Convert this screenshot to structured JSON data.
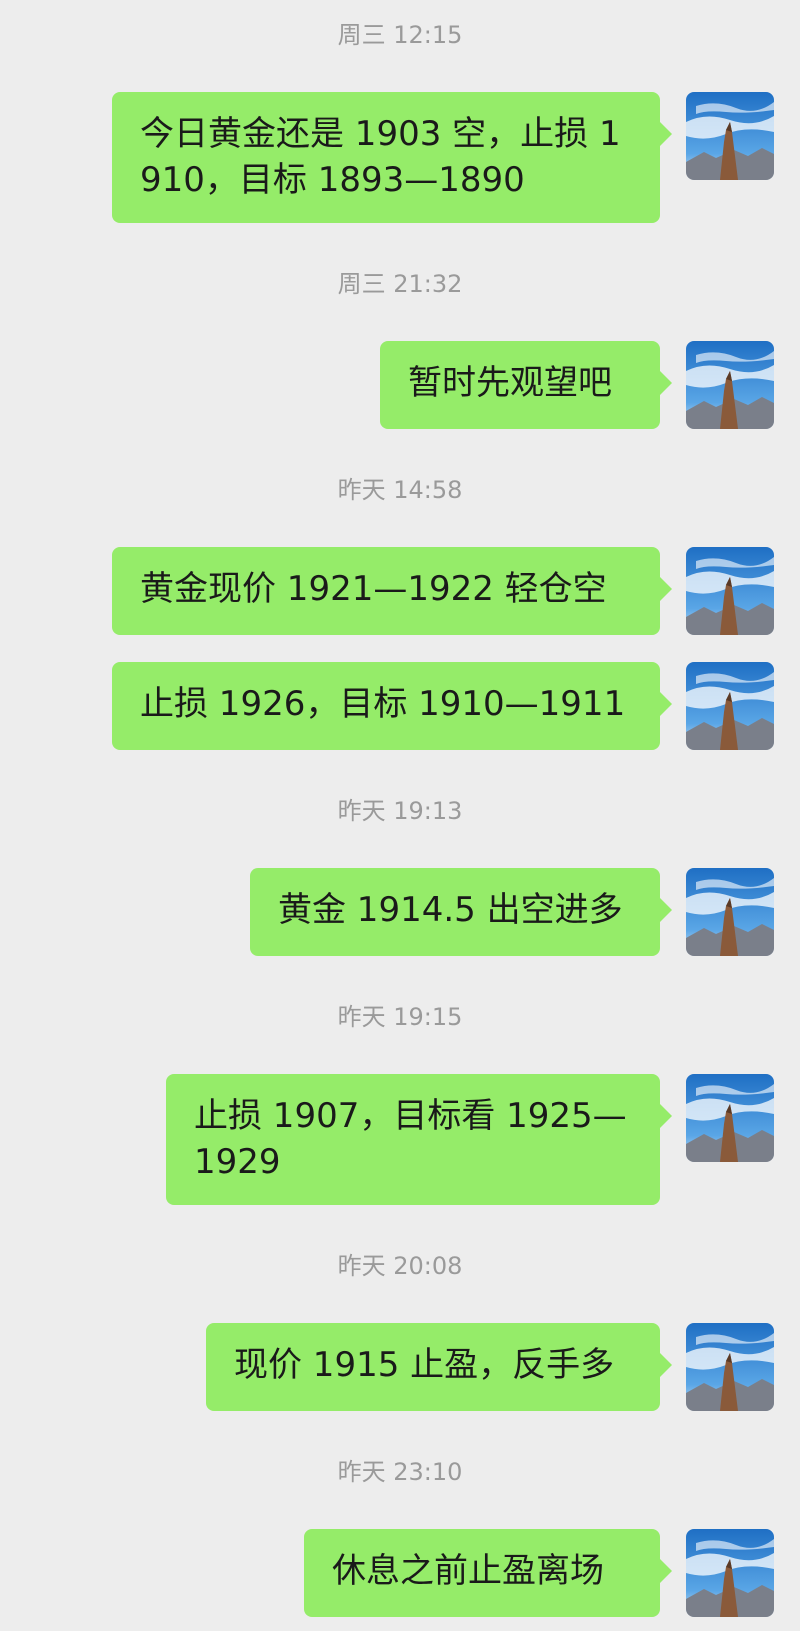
{
  "chat": {
    "messages": [
      {
        "time": "周三 12:15",
        "bubbles": [
          "今日黄金还是 1903 空，止损 1910，目标 1893—1890"
        ]
      },
      {
        "time": "周三 21:32",
        "bubbles": [
          "暂时先观望吧"
        ]
      },
      {
        "time": "昨天 14:58",
        "bubbles": [
          "黄金现价 1921—1922 轻仓空",
          "止损 1926，目标 1910—1911"
        ]
      },
      {
        "time": "昨天 19:13",
        "bubbles": [
          "黄金 1914.5 出空进多"
        ]
      },
      {
        "time": "昨天 19:15",
        "bubbles": [
          "止损 1907，目标看 1925—1929"
        ]
      },
      {
        "time": "昨天 20:08",
        "bubbles": [
          "现价 1915 止盈，反手多"
        ]
      },
      {
        "time": "昨天 23:10",
        "bubbles": [
          "休息之前止盈离场"
        ]
      }
    ]
  },
  "colors": {
    "background": "#ededed",
    "bubble": "#95ec69",
    "timestamp": "#9a9a9a"
  },
  "icons": {
    "avatar": "avatar-mountain-sky-icon"
  }
}
